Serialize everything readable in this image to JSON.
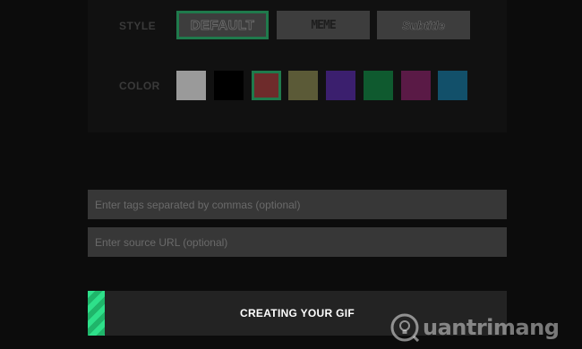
{
  "style_section": {
    "label": "STYLE",
    "options": [
      {
        "label": "DEFAULT",
        "selected": true
      },
      {
        "label": "MEME",
        "selected": false
      },
      {
        "label": "Subtitle",
        "selected": false
      }
    ]
  },
  "color_section": {
    "label": "COLOR",
    "swatches": [
      {
        "name": "gray",
        "color": "#9a9a9a",
        "selected": false
      },
      {
        "name": "black",
        "color": "#000000",
        "selected": false
      },
      {
        "name": "red",
        "color": "#6e2b2b",
        "selected": true
      },
      {
        "name": "olive",
        "color": "#5b5a37",
        "selected": false
      },
      {
        "name": "purple",
        "color": "#3b1f6e",
        "selected": false
      },
      {
        "name": "green",
        "color": "#0f5a2f",
        "selected": false
      },
      {
        "name": "magenta",
        "color": "#5a1a46",
        "selected": false
      },
      {
        "name": "blue",
        "color": "#12506a",
        "selected": false
      }
    ]
  },
  "tags_input": {
    "placeholder": "Enter tags separated by commas (optional)",
    "value": ""
  },
  "source_input": {
    "placeholder": "Enter source URL (optional)",
    "value": ""
  },
  "progress": {
    "label": "CREATING YOUR GIF",
    "fraction": 0.04,
    "fill_color": "#2ee08a"
  },
  "watermark": {
    "text": "uantrimang"
  },
  "colors": {
    "accent": "#1f7a4c",
    "background": "#0c0c0c"
  }
}
